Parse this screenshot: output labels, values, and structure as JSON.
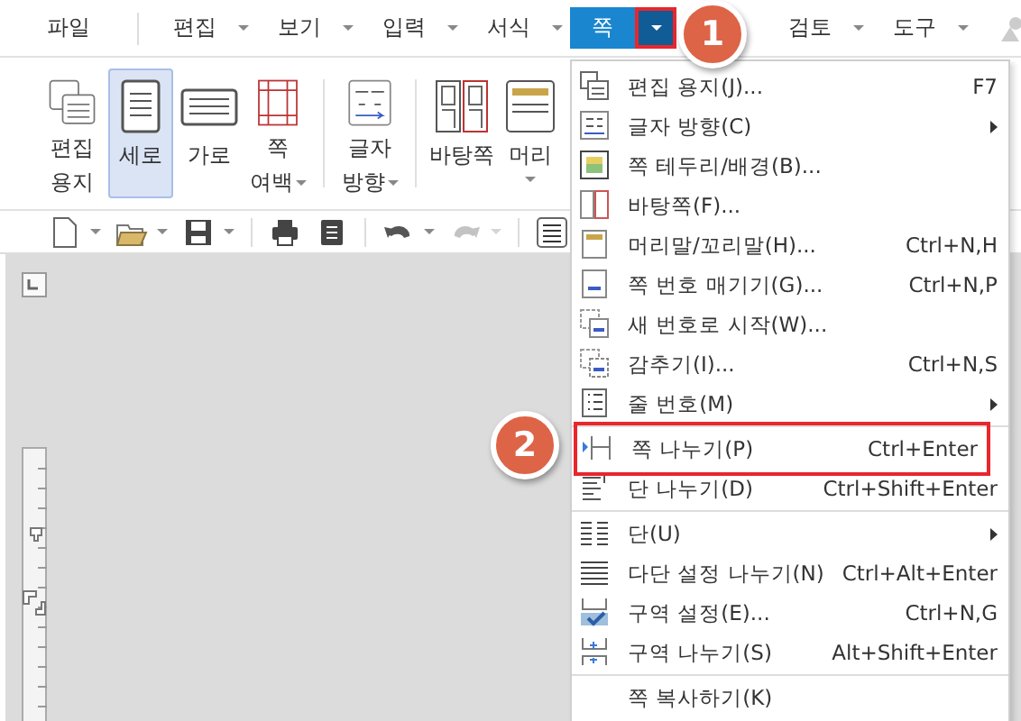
{
  "menubar": {
    "items": [
      {
        "label": "파일",
        "has_dropdown": false,
        "selected": false
      },
      {
        "label": "편집",
        "has_dropdown": true,
        "selected": false
      },
      {
        "label": "보기",
        "has_dropdown": true,
        "selected": false
      },
      {
        "label": "입력",
        "has_dropdown": true,
        "selected": false
      },
      {
        "label": "서식",
        "has_dropdown": true,
        "selected": false
      },
      {
        "label": "쪽",
        "has_dropdown": true,
        "selected": true,
        "arrow_marked": true
      },
      {
        "label": "검토",
        "has_dropdown": true,
        "selected": false
      },
      {
        "label": "도구",
        "has_dropdown": true,
        "selected": false
      }
    ]
  },
  "ribbon": {
    "buttons": [
      {
        "kind": "button",
        "lines": [
          "편집",
          "용지"
        ],
        "selected": false,
        "has_dropdown": false
      },
      {
        "kind": "button",
        "lines": [
          "세로"
        ],
        "selected": true,
        "has_dropdown": false
      },
      {
        "kind": "button",
        "lines": [
          "가로"
        ],
        "selected": false,
        "has_dropdown": false
      },
      {
        "kind": "button",
        "lines": [
          "쪽",
          "여백"
        ],
        "selected": false,
        "has_dropdown": true
      },
      {
        "kind": "separator"
      },
      {
        "kind": "button",
        "lines": [
          "글자",
          "방향"
        ],
        "selected": false,
        "has_dropdown": true
      },
      {
        "kind": "separator"
      },
      {
        "kind": "button",
        "lines": [
          "바탕쪽"
        ],
        "selected": false,
        "has_dropdown": false
      },
      {
        "kind": "button",
        "lines": [
          "머리"
        ],
        "selected": false,
        "has_dropdown": true
      }
    ]
  },
  "toolbar": {
    "buttons": [
      {
        "kind": "new",
        "has_dropdown": true,
        "disabled": false
      },
      {
        "kind": "open",
        "has_dropdown": true,
        "disabled": false
      },
      {
        "kind": "save",
        "has_dropdown": true,
        "disabled": false
      },
      {
        "kind": "separator"
      },
      {
        "kind": "print",
        "has_dropdown": false,
        "disabled": false
      },
      {
        "kind": "preview",
        "has_dropdown": false,
        "disabled": false
      },
      {
        "kind": "separator"
      },
      {
        "kind": "undo",
        "has_dropdown": true,
        "disabled": false
      },
      {
        "kind": "redo",
        "has_dropdown": true,
        "disabled": true
      },
      {
        "kind": "separator"
      },
      {
        "kind": "align",
        "has_dropdown": false,
        "disabled": false
      }
    ]
  },
  "page_menu": {
    "items": [
      {
        "kind": "item",
        "label": "편집 용지(J)...",
        "shortcut": "F7",
        "has_submenu": false,
        "marked": false
      },
      {
        "kind": "item",
        "label": "글자 방향(C)",
        "has_submenu": true,
        "marked": false
      },
      {
        "kind": "item",
        "label": "쪽 테두리/배경(B)...",
        "has_submenu": false,
        "marked": false
      },
      {
        "kind": "item",
        "label": "바탕쪽(F)...",
        "has_submenu": false,
        "marked": false
      },
      {
        "kind": "item",
        "label": "머리말/꼬리말(H)...",
        "shortcut": "Ctrl+N,H",
        "has_submenu": false,
        "marked": false
      },
      {
        "kind": "item",
        "label": "쪽 번호 매기기(G)...",
        "shortcut": "Ctrl+N,P",
        "has_submenu": false,
        "marked": false
      },
      {
        "kind": "item",
        "label": "새 번호로 시작(W)...",
        "has_submenu": false,
        "marked": false
      },
      {
        "kind": "item",
        "label": "감추기(I)...",
        "shortcut": "Ctrl+N,S",
        "has_submenu": false,
        "marked": false
      },
      {
        "kind": "item",
        "label": "줄 번호(M)",
        "has_submenu": true,
        "marked": false
      },
      {
        "kind": "separator"
      },
      {
        "kind": "item",
        "label": "쪽 나누기(P)",
        "shortcut": "Ctrl+Enter",
        "has_submenu": false,
        "marked": true
      },
      {
        "kind": "item",
        "label": "단 나누기(D)",
        "shortcut": "Ctrl+Shift+Enter",
        "has_submenu": false,
        "marked": false
      },
      {
        "kind": "separator"
      },
      {
        "kind": "item",
        "label": "단(U)",
        "has_submenu": true,
        "marked": false
      },
      {
        "kind": "item",
        "label": "다단 설정 나누기(N)",
        "shortcut": "Ctrl+Alt+Enter",
        "has_submenu": false,
        "marked": false
      },
      {
        "kind": "item",
        "label": "구역 설정(E)...",
        "shortcut": "Ctrl+N,G",
        "has_submenu": false,
        "marked": false
      },
      {
        "kind": "item",
        "label": "구역 나누기(S)",
        "shortcut": "Alt+Shift+Enter",
        "has_submenu": false,
        "marked": false
      },
      {
        "kind": "separator"
      },
      {
        "kind": "item",
        "label": "쪽 복사하기(K)",
        "has_submenu": false,
        "marked": false
      }
    ]
  },
  "callouts": [
    {
      "number": "1"
    },
    {
      "number": "2"
    }
  ]
}
